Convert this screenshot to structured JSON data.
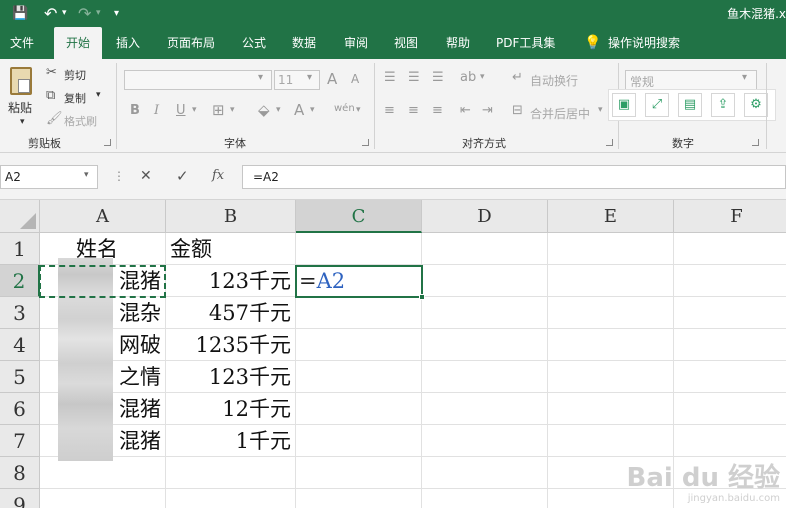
{
  "window": {
    "title": "鱼木混猪.x"
  },
  "qat": {
    "save_icon": "💾",
    "undo_icon": "↶",
    "redo_icon": "↷",
    "more_icon": "▾"
  },
  "tabs": [
    "文件",
    "开始",
    "插入",
    "页面布局",
    "公式",
    "数据",
    "审阅",
    "视图",
    "帮助",
    "PDF工具集",
    "操作说明搜索"
  ],
  "tabs_active": "开始",
  "ribbon": {
    "clipboard": {
      "paste": "粘贴",
      "cut": "剪切",
      "copy": "复制",
      "format_painter": "格式刷",
      "label": "剪贴板"
    },
    "font": {
      "size": "11",
      "grow": "A",
      "shrink": "A",
      "bold": "B",
      "italic": "I",
      "underline": "U",
      "font_color": "A",
      "phonetic": "wén",
      "label": "字体"
    },
    "align": {
      "wrap": "自动换行",
      "merge": "合并后居中",
      "label": "对齐方式"
    },
    "number": {
      "format": "常规",
      "label": "数字"
    }
  },
  "formula_bar": {
    "name_box": "A2",
    "cancel": "✕",
    "enter": "✓",
    "fx": "fx",
    "content": "=A2"
  },
  "grid": {
    "columns": [
      "A",
      "B",
      "C",
      "D",
      "E",
      "F"
    ],
    "rows": [
      "1",
      "2",
      "3",
      "4",
      "5",
      "6",
      "7",
      "8",
      "9"
    ],
    "header": {
      "a": "姓名",
      "b": "金额"
    },
    "data": [
      {
        "a": "混猪",
        "b": "123千元"
      },
      {
        "a": "混杂",
        "b": "457千元"
      },
      {
        "a": "网破",
        "b": "1235千元"
      },
      {
        "a": "之情",
        "b": "123千元"
      },
      {
        "a": "混猪",
        "b": "12千元"
      },
      {
        "a": "混猪",
        "b": "1千元"
      }
    ],
    "editing": {
      "prefix": "=",
      "ref": "A2"
    }
  },
  "watermark": {
    "brand": "Bai du 经验",
    "url": "jingyan.baidu.com"
  },
  "colors": {
    "excel_green": "#217346",
    "ref_blue": "#2f63c0"
  }
}
